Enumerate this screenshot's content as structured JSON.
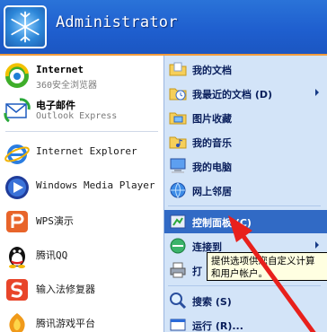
{
  "header": {
    "username": "Administrator"
  },
  "left_items": [
    {
      "name": "program-internet",
      "title": "Internet",
      "subtitle": "360安全浏览器",
      "icon": "360-browser-icon"
    },
    {
      "name": "program-email",
      "title": "电子邮件",
      "subtitle": "Outlook Express",
      "icon": "outlook-express-icon"
    },
    {
      "name": "program-ie",
      "label": "Internet Explorer",
      "icon": "internet-explorer-icon"
    },
    {
      "name": "program-wmp",
      "label": "Windows Media Player",
      "icon": "windows-media-player-icon"
    },
    {
      "name": "program-wps",
      "label": "WPS演示",
      "icon": "wps-presentation-icon"
    },
    {
      "name": "program-qq",
      "label": "腾讯QQ",
      "icon": "qq-penguin-icon"
    },
    {
      "name": "program-ime",
      "label": "输入法修复器",
      "icon": "input-method-repair-icon"
    },
    {
      "name": "program-qqgame",
      "label": "腾讯游戏平台",
      "icon": "tencent-game-icon"
    }
  ],
  "right_items": [
    {
      "name": "my-documents",
      "label": "我的文档",
      "icon": "folder-documents-icon",
      "arrow": false
    },
    {
      "name": "recent-documents",
      "label": "我最近的文档 (D)",
      "icon": "recent-docs-folder-icon",
      "arrow": true
    },
    {
      "name": "my-pictures",
      "label": "图片收藏",
      "icon": "folder-pictures-icon",
      "arrow": false
    },
    {
      "name": "my-music",
      "label": "我的音乐",
      "icon": "folder-music-icon",
      "arrow": false
    },
    {
      "name": "my-computer",
      "label": "我的电脑",
      "icon": "computer-icon",
      "arrow": false
    },
    {
      "name": "network-places",
      "label": "网上邻居",
      "icon": "network-places-icon",
      "arrow": false
    },
    {
      "name": "control-panel",
      "label": "控制面板 (C)",
      "icon": "control-panel-icon",
      "arrow": false,
      "highlighted": true
    },
    {
      "name": "connect-to",
      "label": "连接到",
      "icon": "connect-to-icon",
      "arrow": true
    },
    {
      "name": "printers",
      "label": "打",
      "icon": "printer-icon",
      "arrow": false
    },
    {
      "name": "search",
      "label": "搜索 (S)",
      "icon": "search-icon",
      "arrow": false
    },
    {
      "name": "run",
      "label": "运行 (R)...",
      "icon": "run-icon",
      "arrow": false
    }
  ],
  "tooltip": {
    "line1": "提供选项供您自定义计算",
    "line2": "和用户帐户。"
  },
  "colors": {
    "header": "#1f5fcf",
    "right_panel": "#d3e4f8",
    "highlight": "#316ac5",
    "annotation_arrow": "#e8201c"
  }
}
